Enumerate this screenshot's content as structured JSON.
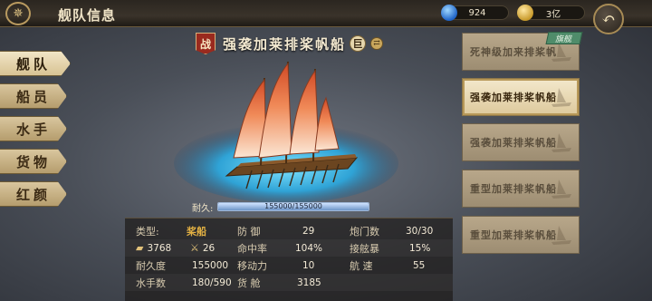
{
  "header": {
    "title": "舰队信息",
    "back_icon": "back-arrow-icon"
  },
  "resources": {
    "gems": "924",
    "gold": "3亿"
  },
  "nav": {
    "items": [
      {
        "label": "舰队",
        "active": true
      },
      {
        "label": "船员",
        "active": false
      },
      {
        "label": "水手",
        "active": false
      },
      {
        "label": "货物",
        "active": false
      },
      {
        "label": "红颜",
        "active": false
      }
    ]
  },
  "ship": {
    "badge": "战",
    "name": "强袭加莱排桨帆船",
    "size_badge": "巨",
    "durability_label": "耐久:",
    "durability_text": "155000/155000",
    "durability_fraction": 1.0
  },
  "stats": {
    "type_label": "类型:",
    "type_value": "桨船",
    "defense_label": "防 御",
    "defense_value": "29",
    "ports_label": "炮门数",
    "ports_value": "30/30",
    "cannon_value": "3768",
    "melee_value": "26",
    "hit_label": "命中率",
    "hit_value": "104%",
    "board_label": "接舷暴",
    "board_value": "15%",
    "endurance_label": "耐久度",
    "endurance_value": "155000",
    "mobility_label": "移动力",
    "mobility_value": "10",
    "speed_label": "航 速",
    "speed_value": "55",
    "sailors_label": "水手数",
    "sailors_value": "180/590",
    "cargo_label": "货 舱",
    "cargo_value": "3185"
  },
  "fleet": {
    "flagship_badge": "旗舰",
    "ships": [
      {
        "name": "死神级加来排桨帆",
        "active": false
      },
      {
        "name": "强袭加莱排桨帆船",
        "active": true
      },
      {
        "name": "强袭加莱排桨帆船",
        "active": false
      },
      {
        "name": "重型加莱排桨帆船",
        "active": false
      },
      {
        "name": "重型加莱排桨帆船",
        "active": false
      }
    ]
  },
  "colors": {
    "accent_gold": "#e2b043",
    "badge_red": "#9a2a1e",
    "flag_green": "#4f8c6a"
  }
}
